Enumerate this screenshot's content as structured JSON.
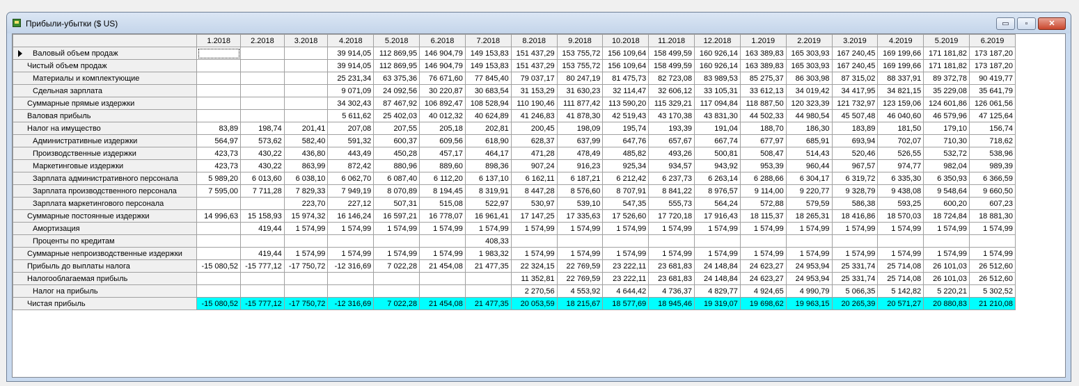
{
  "window": {
    "title": "Прибыли-убытки ($ US)",
    "buttons": {
      "minimize": "▭",
      "maximize": "▫",
      "close": "✕"
    }
  },
  "colors": {
    "highlight_row": "#00ffff",
    "header_bg": "#f0f0f0",
    "title_bar": "#c9daef"
  },
  "grid": {
    "columns": [
      "1.2018",
      "2.2018",
      "3.2018",
      "4.2018",
      "5.2018",
      "6.2018",
      "7.2018",
      "8.2018",
      "9.2018",
      "10.2018",
      "11.2018",
      "12.2018",
      "1.2019",
      "2.2019",
      "3.2019",
      "4.2019",
      "5.2019",
      "6.2019"
    ],
    "rows": [
      {
        "label": "Валовый объем продаж",
        "indent": 1,
        "current": true,
        "values": [
          "",
          "",
          "",
          "39 914,05",
          "112 869,95",
          "146 904,79",
          "149 153,83",
          "151 437,29",
          "153 755,72",
          "156 109,64",
          "158 499,59",
          "160 926,14",
          "163 389,83",
          "165 303,93",
          "167 240,45",
          "169 199,66",
          "171 181,82",
          "173 187,20"
        ]
      },
      {
        "label": "Чистый объем продаж",
        "indent": 0,
        "values": [
          "",
          "",
          "",
          "39 914,05",
          "112 869,95",
          "146 904,79",
          "149 153,83",
          "151 437,29",
          "153 755,72",
          "156 109,64",
          "158 499,59",
          "160 926,14",
          "163 389,83",
          "165 303,93",
          "167 240,45",
          "169 199,66",
          "171 181,82",
          "173 187,20"
        ]
      },
      {
        "label": "Материалы и комплектующие",
        "indent": 1,
        "values": [
          "",
          "",
          "",
          "25 231,34",
          "63 375,36",
          "76 671,60",
          "77 845,40",
          "79 037,17",
          "80 247,19",
          "81 475,73",
          "82 723,08",
          "83 989,53",
          "85 275,37",
          "86 303,98",
          "87 315,02",
          "88 337,91",
          "89 372,78",
          "90 419,77"
        ]
      },
      {
        "label": "Сдельная зарплата",
        "indent": 1,
        "values": [
          "",
          "",
          "",
          "9 071,09",
          "24 092,56",
          "30 220,87",
          "30 683,54",
          "31 153,29",
          "31 630,23",
          "32 114,47",
          "32 606,12",
          "33 105,31",
          "33 612,13",
          "34 019,42",
          "34 417,95",
          "34 821,15",
          "35 229,08",
          "35 641,79"
        ]
      },
      {
        "label": "Суммарные прямые издержки",
        "indent": 0,
        "values": [
          "",
          "",
          "",
          "34 302,43",
          "87 467,92",
          "106 892,47",
          "108 528,94",
          "110 190,46",
          "111 877,42",
          "113 590,20",
          "115 329,21",
          "117 094,84",
          "118 887,50",
          "120 323,39",
          "121 732,97",
          "123 159,06",
          "124 601,86",
          "126 061,56"
        ]
      },
      {
        "label": "Валовая прибыль",
        "indent": 0,
        "values": [
          "",
          "",
          "",
          "5 611,62",
          "25 402,03",
          "40 012,32",
          "40 624,89",
          "41 246,83",
          "41 878,30",
          "42 519,43",
          "43 170,38",
          "43 831,30",
          "44 502,33",
          "44 980,54",
          "45 507,48",
          "46 040,60",
          "46 579,96",
          "47 125,64"
        ]
      },
      {
        "label": "Налог на имущество",
        "indent": 0,
        "values": [
          "83,89",
          "198,74",
          "201,41",
          "207,08",
          "207,55",
          "205,18",
          "202,81",
          "200,45",
          "198,09",
          "195,74",
          "193,39",
          "191,04",
          "188,70",
          "186,30",
          "183,89",
          "181,50",
          "179,10",
          "156,74"
        ]
      },
      {
        "label": "Административные издержки",
        "indent": 1,
        "values": [
          "564,97",
          "573,62",
          "582,40",
          "591,32",
          "600,37",
          "609,56",
          "618,90",
          "628,37",
          "637,99",
          "647,76",
          "657,67",
          "667,74",
          "677,97",
          "685,91",
          "693,94",
          "702,07",
          "710,30",
          "718,62"
        ]
      },
      {
        "label": "Производственные издержки",
        "indent": 1,
        "values": [
          "423,73",
          "430,22",
          "436,80",
          "443,49",
          "450,28",
          "457,17",
          "464,17",
          "471,28",
          "478,49",
          "485,82",
          "493,26",
          "500,81",
          "508,47",
          "514,43",
          "520,46",
          "526,55",
          "532,72",
          "538,96"
        ]
      },
      {
        "label": "Маркетинговые издержки",
        "indent": 1,
        "values": [
          "423,73",
          "430,22",
          "863,99",
          "872,42",
          "880,96",
          "889,60",
          "898,36",
          "907,24",
          "916,23",
          "925,34",
          "934,57",
          "943,92",
          "953,39",
          "960,44",
          "967,57",
          "974,77",
          "982,04",
          "989,39"
        ]
      },
      {
        "label": "Зарплата административного персонала",
        "indent": 1,
        "values": [
          "5 989,20",
          "6 013,60",
          "6 038,10",
          "6 062,70",
          "6 087,40",
          "6 112,20",
          "6 137,10",
          "6 162,11",
          "6 187,21",
          "6 212,42",
          "6 237,73",
          "6 263,14",
          "6 288,66",
          "6 304,17",
          "6 319,72",
          "6 335,30",
          "6 350,93",
          "6 366,59"
        ]
      },
      {
        "label": "Зарплата производственного персонала",
        "indent": 1,
        "values": [
          "7 595,00",
          "7 711,28",
          "7 829,33",
          "7 949,19",
          "8 070,89",
          "8 194,45",
          "8 319,91",
          "8 447,28",
          "8 576,60",
          "8 707,91",
          "8 841,22",
          "8 976,57",
          "9 114,00",
          "9 220,77",
          "9 328,79",
          "9 438,08",
          "9 548,64",
          "9 660,50"
        ]
      },
      {
        "label": "Зарплата маркетингового персонала",
        "indent": 1,
        "values": [
          "",
          "",
          "223,70",
          "227,12",
          "507,31",
          "515,08",
          "522,97",
          "530,97",
          "539,10",
          "547,35",
          "555,73",
          "564,24",
          "572,88",
          "579,59",
          "586,38",
          "593,25",
          "600,20",
          "607,23"
        ]
      },
      {
        "label": "Суммарные постоянные издержки",
        "indent": 0,
        "values": [
          "14 996,63",
          "15 158,93",
          "15 974,32",
          "16 146,24",
          "16 597,21",
          "16 778,07",
          "16 961,41",
          "17 147,25",
          "17 335,63",
          "17 526,60",
          "17 720,18",
          "17 916,43",
          "18 115,37",
          "18 265,31",
          "18 416,86",
          "18 570,03",
          "18 724,84",
          "18 881,30"
        ]
      },
      {
        "label": "Амортизация",
        "indent": 1,
        "values": [
          "",
          "419,44",
          "1 574,99",
          "1 574,99",
          "1 574,99",
          "1 574,99",
          "1 574,99",
          "1 574,99",
          "1 574,99",
          "1 574,99",
          "1 574,99",
          "1 574,99",
          "1 574,99",
          "1 574,99",
          "1 574,99",
          "1 574,99",
          "1 574,99",
          "1 574,99"
        ]
      },
      {
        "label": "Проценты по кредитам",
        "indent": 1,
        "values": [
          "",
          "",
          "",
          "",
          "",
          "",
          "408,33",
          "",
          "",
          "",
          "",
          "",
          "",
          "",
          "",
          "",
          "",
          ""
        ]
      },
      {
        "label": "Суммарные непроизводственные издержки",
        "indent": 0,
        "values": [
          "",
          "419,44",
          "1 574,99",
          "1 574,99",
          "1 574,99",
          "1 574,99",
          "1 983,32",
          "1 574,99",
          "1 574,99",
          "1 574,99",
          "1 574,99",
          "1 574,99",
          "1 574,99",
          "1 574,99",
          "1 574,99",
          "1 574,99",
          "1 574,99",
          "1 574,99"
        ]
      },
      {
        "label": "Прибыль до выплаты налога",
        "indent": 0,
        "values": [
          "-15 080,52",
          "-15 777,12",
          "-17 750,72",
          "-12 316,69",
          "7 022,28",
          "21 454,08",
          "21 477,35",
          "22 324,15",
          "22 769,59",
          "23 222,11",
          "23 681,83",
          "24 148,84",
          "24 623,27",
          "24 953,94",
          "25 331,74",
          "25 714,08",
          "26 101,03",
          "26 512,60"
        ]
      },
      {
        "label": "Налогооблагаемая прибыль",
        "indent": 0,
        "values": [
          "",
          "",
          "",
          "",
          "",
          "",
          "",
          "11 352,81",
          "22 769,59",
          "23 222,11",
          "23 681,83",
          "24 148,84",
          "24 623,27",
          "24 953,94",
          "25 331,74",
          "25 714,08",
          "26 101,03",
          "26 512,60"
        ]
      },
      {
        "label": "Налог на прибыль",
        "indent": 1,
        "values": [
          "",
          "",
          "",
          "",
          "",
          "",
          "",
          "2 270,56",
          "4 553,92",
          "4 644,42",
          "4 736,37",
          "4 829,77",
          "4 924,65",
          "4 990,79",
          "5 066,35",
          "5 142,82",
          "5 220,21",
          "5 302,52"
        ]
      },
      {
        "label": "Чистая прибыль",
        "indent": 0,
        "highlight": true,
        "values": [
          "-15 080,52",
          "-15 777,12",
          "-17 750,72",
          "-12 316,69",
          "7 022,28",
          "21 454,08",
          "21 477,35",
          "20 053,59",
          "18 215,67",
          "18 577,69",
          "18 945,46",
          "19 319,07",
          "19 698,62",
          "19 963,15",
          "20 265,39",
          "20 571,27",
          "20 880,83",
          "21 210,08"
        ]
      }
    ]
  }
}
